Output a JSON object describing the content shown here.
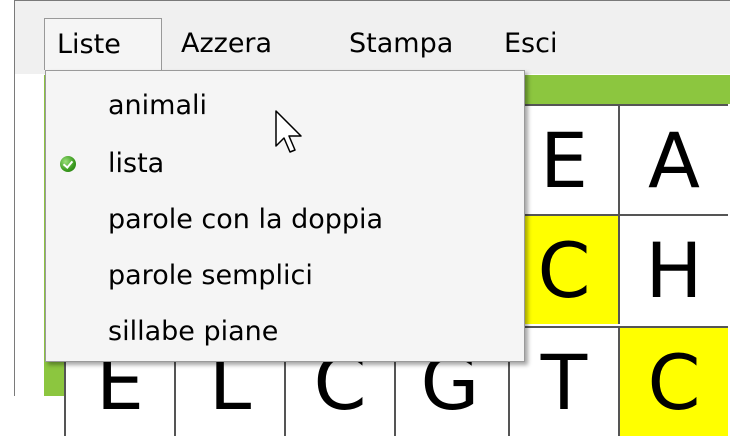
{
  "menubar": {
    "items": [
      "Liste",
      "Azzera",
      "Stampa",
      "Esci"
    ],
    "active": "Liste"
  },
  "dropdown": {
    "items": [
      {
        "label": "animali",
        "checked": false
      },
      {
        "label": "lista",
        "checked": true
      },
      {
        "label": "parole con la doppia",
        "checked": false
      },
      {
        "label": "parole semplici",
        "checked": false
      },
      {
        "label": "sillabe piane",
        "checked": false
      }
    ]
  },
  "grid": {
    "rows": [
      [
        "",
        "",
        "",
        "",
        "E",
        "A"
      ],
      [
        "",
        "",
        "",
        "",
        "C",
        "H"
      ],
      [
        "E",
        "L",
        "C",
        "G",
        "T",
        "C"
      ]
    ],
    "highlighted": [
      [
        1,
        4
      ],
      [
        2,
        5
      ]
    ]
  },
  "colors": {
    "menubar": "#f0f0f0",
    "green_band": "#8cc63f",
    "highlight": "#ffff00",
    "check": "#3a9a1e"
  },
  "icons": {
    "checked": "check-icon",
    "pointer": "cursor-icon"
  }
}
